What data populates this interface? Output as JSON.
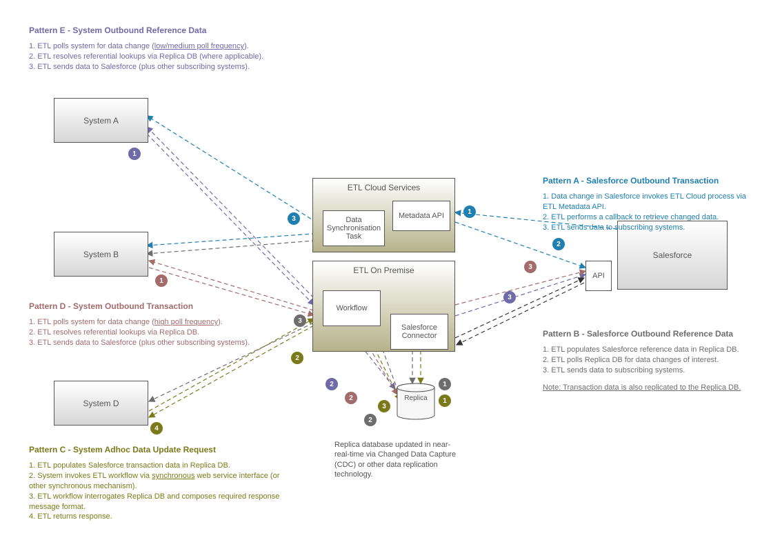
{
  "patterns": {
    "E": {
      "title": "Pattern E - System Outbound Reference Data",
      "line1a": "1. ETL polls system for data change (",
      "line1b": "low/medium poll frequency",
      "line1c": ").",
      "line2": "2. ETL resolves referential lookups via Replica DB (where applicable).",
      "line3": "3. ETL sends data to Salesforce (plus other subscribing systems).",
      "color": "#6f6aa8"
    },
    "D": {
      "title": "Pattern D - System Outbound Transaction",
      "line1a": "1. ETL polls system for data change (",
      "line1b": "high poll frequency",
      "line1c": ").",
      "line2": "2. ETL resolves referential lookups via Replica DB.",
      "line3": "3. ETL sends data to Salesforce (plus other subscribing systems).",
      "color": "#a36b6b"
    },
    "C": {
      "title": "Pattern C - System Adhoc Data Update Request",
      "line1": "1. ETL populates Salesforce transaction data in Replica DB.",
      "line2a": "2. System invokes ETL workflow via ",
      "line2b": "synchronous",
      "line2c": " web service interface (or other synchronous mechanism).",
      "line3": "3. ETL workflow interrogates Replica DB and composes required response message format.",
      "line4": "4. ETL returns response.",
      "color": "#7b7a1a"
    },
    "A": {
      "title": "Pattern A - Salesforce Outbound Transaction",
      "line1": "1. Data change in Salesforce invokes ETL Cloud process via ETL Metadata API.",
      "line2": "2. ETL performs a callback to retrieve changed data.",
      "line3": "3. ETL sends data to subscribing systems.",
      "color": "#1e7fb0"
    },
    "B": {
      "title": "Pattern B - Salesforce Outbound Reference Data",
      "line1": "1. ETL populates Salesforce reference data in Replica DB.",
      "line2": "2. ETL polls Replica DB for data changes of interest.",
      "line3": "3. ETL sends data to subscribing systems.",
      "note": "Note: Transaction data is also replicated to the Replica DB.",
      "color": "#6d6d6d"
    }
  },
  "systems": {
    "A": "System A",
    "B": "System B",
    "D": "System D",
    "etlCloud": "ETL Cloud Services",
    "etlPrem": "ETL On Premise",
    "metadata": "Metadata API",
    "sync": "Data Synchronisation Task",
    "workflow": "Workflow",
    "connector": "Salesforce Connector",
    "replica": "Replica",
    "api": "API",
    "salesforce": "Salesforce"
  },
  "replicaNote": "Replica database updated in near-real-time via Changed Data Capture (CDC) or other data replication technology.",
  "badges": {
    "E1": "1",
    "E2": "2",
    "E3": "3",
    "D1": "1",
    "D2": "2",
    "D3": "3",
    "C1": "1",
    "C2": "2",
    "C3": "3",
    "C4": "4",
    "A1": "1",
    "A2": "2",
    "A3": "3",
    "B1": "1",
    "B2": "2",
    "B3": "3"
  },
  "colors": {
    "blue": "#1e7fb0",
    "purple": "#6f6aa8",
    "mauve": "#a36b6b",
    "olive": "#7b7a1a",
    "grey": "#6d6d6d",
    "black": "#333"
  }
}
